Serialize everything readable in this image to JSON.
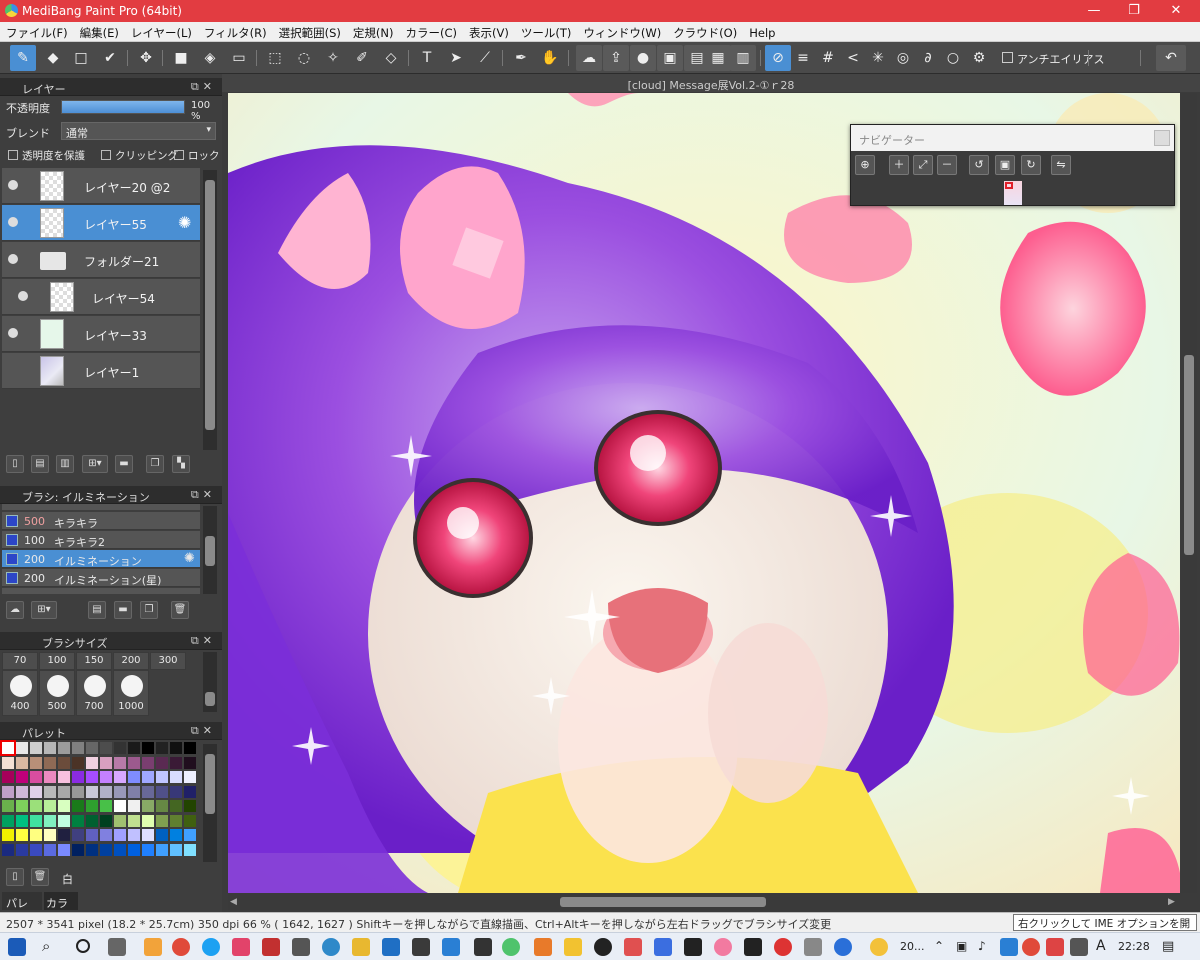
{
  "window": {
    "title": "MediBang Paint Pro (64bit)",
    "controls": {
      "minimize": "—",
      "maximize": "❐",
      "close": "✕"
    }
  },
  "menu": [
    "ファイル(F)",
    "編集(E)",
    "レイヤー(L)",
    "フィルタ(R)",
    "選択範囲(S)",
    "定規(N)",
    "カラー(C)",
    "表示(V)",
    "ツール(T)",
    "ウィンドウ(W)",
    "クラウド(O)",
    "Help"
  ],
  "toolbar": {
    "antialias_label": "アンチエイリアス",
    "antialias_checked": false,
    "tools": [
      "brush-icon",
      "eraser-icon",
      "rectangle-icon",
      "dot-icon",
      "move-icon",
      "fill-rect-icon",
      "bucket-icon",
      "gradient-icon",
      "select-rect-icon",
      "select-ellipse-icon",
      "magic-wand-icon",
      "select-pen-icon",
      "select-eraser-icon",
      "text-icon",
      "operation-icon",
      "divide-icon",
      "eyedropper-icon",
      "hand-icon",
      "cloud-icon",
      "share-icon",
      "balloon-icon",
      "balloon2-icon",
      "frame-icon",
      "layer-panel-icon",
      "snap-icon",
      "snap-off-icon",
      "snap-parallel-icon",
      "snap-grid-icon",
      "snap-cross-icon",
      "snap-radial-icon",
      "snap-concentric-icon",
      "snap-curve-icon",
      "snap-ellipse-icon",
      "settings-icon",
      "undo-icon"
    ]
  },
  "layer_panel": {
    "title": "レイヤー",
    "opacity_label": "不透明度",
    "opacity_value": "100 %",
    "opacity_fraction": 1.0,
    "blend_label": "ブレンド",
    "blend_value": "通常",
    "protect_alpha": "透明度を保護",
    "clipping": "クリッピング",
    "lock": "ロック",
    "layers": [
      {
        "name": "レイヤー20 @2",
        "visible": true,
        "selected": false
      },
      {
        "name": "レイヤー55",
        "visible": true,
        "selected": true
      },
      {
        "name": "フォルダー21",
        "visible": true,
        "selected": false,
        "folder": true
      },
      {
        "name": "レイヤー54",
        "visible": true,
        "selected": false,
        "indented": true
      },
      {
        "name": "レイヤー33",
        "visible": true,
        "selected": false
      },
      {
        "name": "レイヤー1",
        "visible": false,
        "selected": false
      }
    ]
  },
  "brush_panel": {
    "title": "ブラシ: イルミネーション",
    "brushes": [
      {
        "size": "500",
        "name": "キラキラ",
        "selected": false
      },
      {
        "size": "100",
        "name": "キラキラ2",
        "selected": false
      },
      {
        "size": "200",
        "name": "イルミネーション",
        "selected": true
      },
      {
        "size": "200",
        "name": "イルミネーション(星)",
        "selected": false
      }
    ]
  },
  "brush_size_panel": {
    "title": "ブラシサイズ",
    "top_sizes": [
      "70",
      "100",
      "150",
      "200",
      "300"
    ],
    "bottom_sizes": [
      "400",
      "500",
      "700",
      "1000"
    ]
  },
  "palette_panel": {
    "title": "パレット",
    "current_color_name": "白",
    "tabs": [
      "パレット",
      "カラー"
    ]
  },
  "document": {
    "tab_title": "[cloud] Message展Vol.2-①ｒ28"
  },
  "navigator": {
    "title": "ナビゲーター"
  },
  "status": {
    "text": "2507 * 3541 pixel   (18.2 * 25.7cm)   350 dpi   66 %   ( 1642, 1627 )   Shiftキーを押しながらで直線描画、Ctrl+Altキーを押しながら左右ドラッグでブラシサイズ変更",
    "ime_tip": "右クリックして IME オプションを開きます"
  },
  "taskbar": {
    "clock": "22:28",
    "weather": "20..."
  },
  "colors": {
    "title_bar": "#e23c41",
    "selection": "#4a8fd3"
  }
}
